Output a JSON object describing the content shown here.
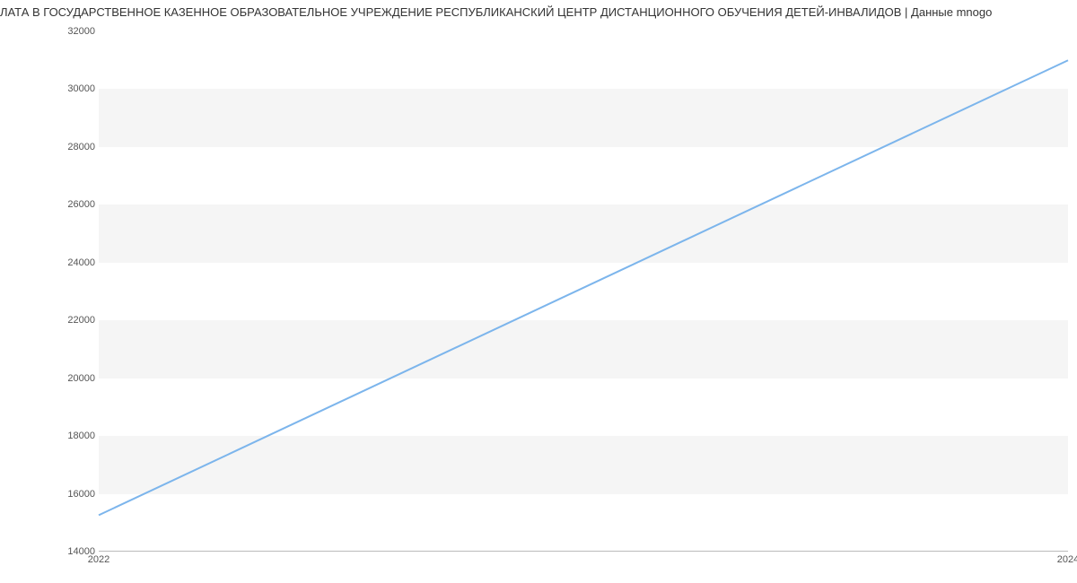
{
  "chart_data": {
    "type": "line",
    "title": "ЛАТА В ГОСУДАРСТВЕННОЕ КАЗЕННОЕ ОБРАЗОВАТЕЛЬНОЕ УЧРЕЖДЕНИЕ РЕСПУБЛИКАНСКИЙ ЦЕНТР ДИСТАНЦИОННОГО ОБУЧЕНИЯ ДЕТЕЙ-ИНВАЛИДОВ | Данные mnogo",
    "x": [
      2022,
      2024
    ],
    "values": [
      15260,
      31000
    ],
    "xlabel": "",
    "ylabel": "",
    "xlim": [
      2022,
      2024
    ],
    "ylim": [
      14000,
      32000
    ],
    "x_ticks": [
      2022,
      2024
    ],
    "y_ticks": [
      14000,
      16000,
      18000,
      20000,
      22000,
      24000,
      26000,
      28000,
      30000,
      32000
    ],
    "line_color": "#7cb5ec",
    "band_color": "#f5f5f5"
  }
}
